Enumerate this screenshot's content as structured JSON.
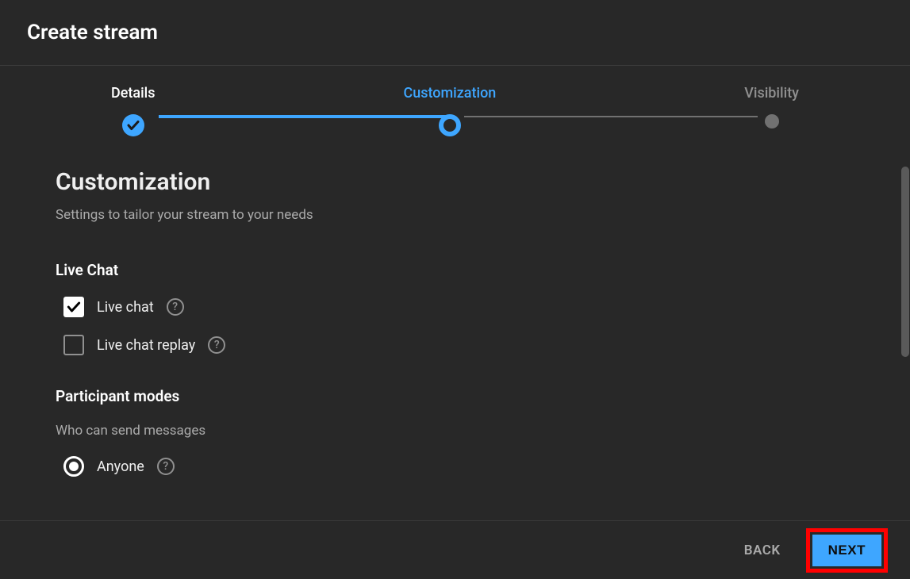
{
  "header": {
    "title": "Create stream"
  },
  "stepper": {
    "steps": [
      {
        "label": "Details",
        "state": "completed"
      },
      {
        "label": "Customization",
        "state": "active"
      },
      {
        "label": "Visibility",
        "state": "inactive"
      }
    ]
  },
  "customization": {
    "title": "Customization",
    "subtitle": "Settings to tailor your stream to your needs",
    "live_chat": {
      "heading": "Live Chat",
      "options": {
        "live_chat_label": "Live chat",
        "live_chat_checked": true,
        "replay_label": "Live chat replay",
        "replay_checked": false
      }
    },
    "participant": {
      "heading": "Participant modes",
      "description": "Who can send messages",
      "anyone_label": "Anyone",
      "anyone_selected": true
    }
  },
  "footer": {
    "back_label": "BACK",
    "next_label": "NEXT"
  }
}
